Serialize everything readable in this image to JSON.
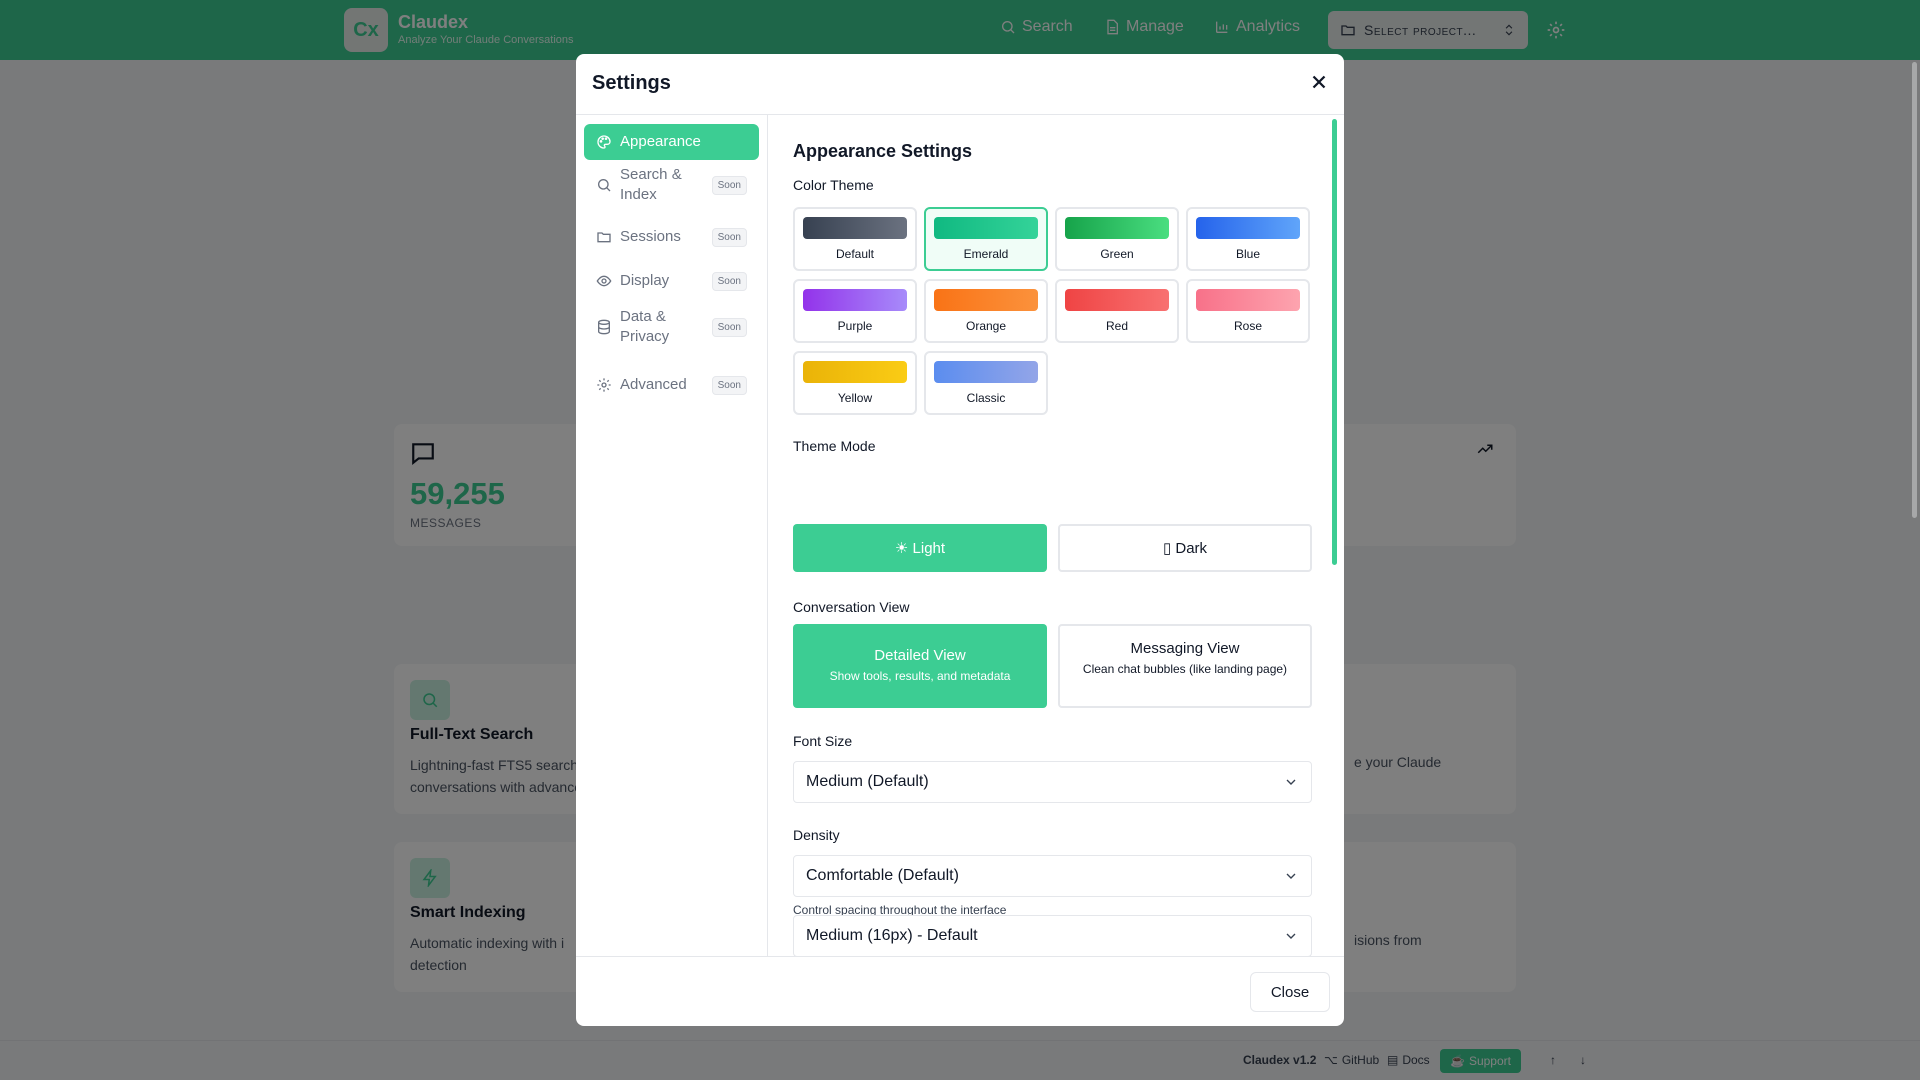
{
  "app": {
    "logo_text": "Cx",
    "title": "Claudex",
    "subtitle": "Analyze Your Claude Conversations"
  },
  "nav": {
    "search": "Search",
    "manage": "Manage",
    "analytics": "Analytics",
    "project_select": "Select project...",
    "settings_icon": "gear-icon"
  },
  "background": {
    "stat_value": "59,255",
    "stat_label": "MESSAGES",
    "feature1_title": "Full-Text Search",
    "feature1_line1": "Lightning-fast FTS5 search",
    "feature1_line2": "conversations with advanced",
    "feature1_right": "e your Claude",
    "feature2_title": "Smart Indexing",
    "feature2_line1": "Automatic indexing with i",
    "feature2_line2": "detection",
    "feature2_right": "isions from"
  },
  "footer": {
    "version": "Claudex v1.2",
    "github": "GitHub",
    "docs": "Docs",
    "support": "Support"
  },
  "modal": {
    "title": "Settings",
    "close_label": "Close",
    "sidebar": [
      {
        "label": "Appearance",
        "badge": ""
      },
      {
        "label": "Search & Index",
        "badge": "Soon"
      },
      {
        "label": "Sessions",
        "badge": "Soon"
      },
      {
        "label": "Display",
        "badge": "Soon"
      },
      {
        "label": "Data & Privacy",
        "badge": "Soon"
      },
      {
        "label": "Advanced",
        "badge": "Soon"
      }
    ],
    "section_title": "Appearance Settings",
    "color_theme_label": "Color Theme",
    "themes": [
      {
        "name": "Default",
        "color1": "#374151",
        "color2": "#6b7280"
      },
      {
        "name": "Emerald",
        "color1": "#10b981",
        "color2": "#34d399"
      },
      {
        "name": "Green",
        "color1": "#16a34a",
        "color2": "#4ade80"
      },
      {
        "name": "Blue",
        "color1": "#2563eb",
        "color2": "#60a5fa"
      },
      {
        "name": "Purple",
        "color1": "#9333ea",
        "color2": "#a78bfa"
      },
      {
        "name": "Orange",
        "color1": "#f97316",
        "color2": "#fb923c"
      },
      {
        "name": "Red",
        "color1": "#ef4444",
        "color2": "#f87171"
      },
      {
        "name": "Rose",
        "color1": "#f87189",
        "color2": "#fda4af"
      },
      {
        "name": "Yellow",
        "color1": "#eab308",
        "color2": "#facc15"
      },
      {
        "name": "Classic",
        "color1": "#5b8def",
        "color2": "#93a5e8"
      }
    ],
    "selected_theme": "Emerald",
    "theme_mode_label": "Theme Mode",
    "mode_light": "☀ Light",
    "mode_dark": "▯ Dark",
    "conversation_view_label": "Conversation View",
    "view_detailed_title": "Detailed View",
    "view_detailed_desc": "Show tools, results, and metadata",
    "view_messaging_title": "Messaging View",
    "view_messaging_desc": "Clean chat bubbles (like landing page)",
    "font_size_label": "Font Size",
    "font_size_value": "Medium (Default)",
    "density_label": "Density",
    "density_value": "Comfortable (Default)",
    "density_help": "Control spacing throughout the interface",
    "font_size2_label": "Font Size",
    "font_size2_value": "Medium (16px) - Default",
    "accent_color": "#3ccd93"
  }
}
